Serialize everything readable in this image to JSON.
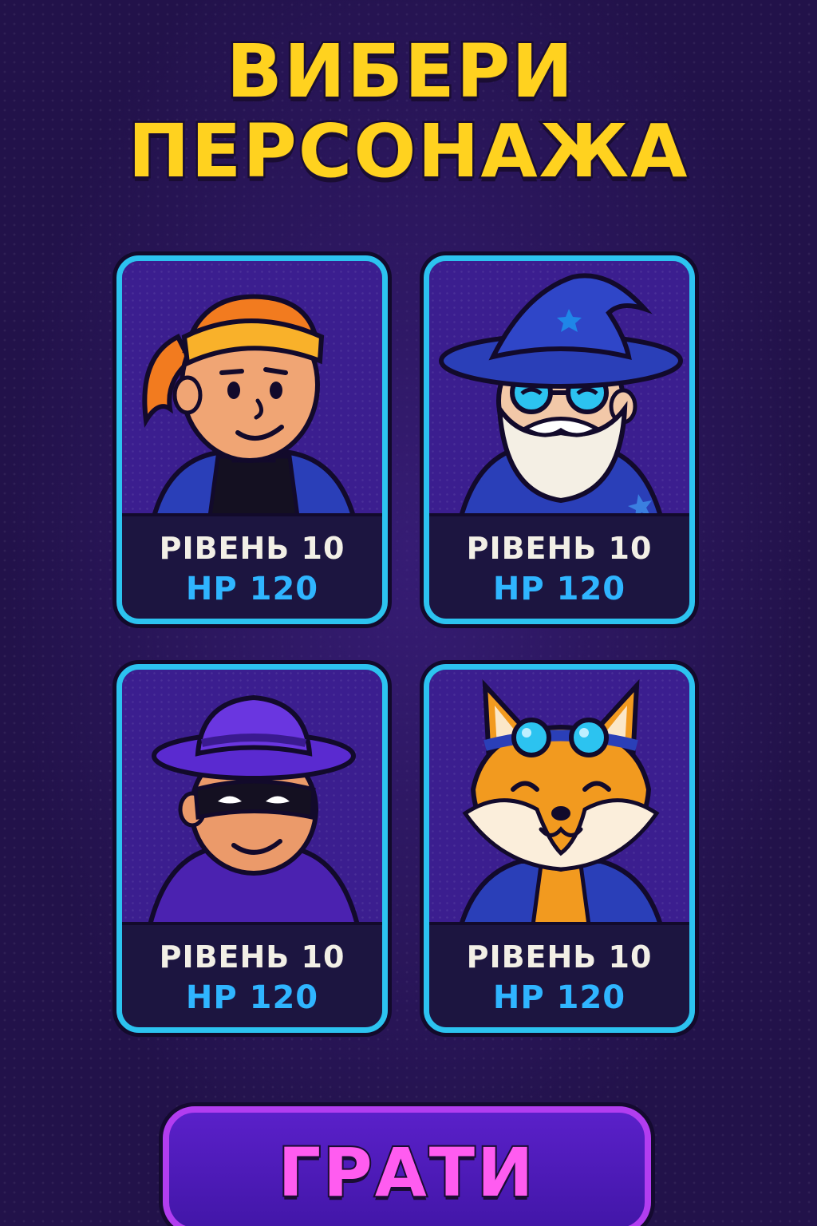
{
  "title": {
    "line1": "ВИБЕРИ",
    "line2": "ПЕРСОНАЖА"
  },
  "characters": [
    {
      "avatar": "adventurer-girl-headband",
      "level_label": "РІВЕНЬ 10",
      "hp_label": "HP 120"
    },
    {
      "avatar": "wizard-with-glasses",
      "level_label": "РІВЕНЬ 10",
      "hp_label": "HP 120"
    },
    {
      "avatar": "masked-thief-with-hat",
      "level_label": "РІВЕНЬ 10",
      "hp_label": "HP 120"
    },
    {
      "avatar": "fox-with-goggles",
      "level_label": "РІВЕНЬ 10",
      "hp_label": "HP 120"
    }
  ],
  "play_button": {
    "label": "ГРАТИ"
  },
  "colors": {
    "background": "#22124a",
    "title": "#ffd21f",
    "card_border": "#2cc3f0",
    "level_text": "#f2efe6",
    "hp_text": "#2fb5ff",
    "play_border": "#b23df0",
    "play_text": "#ff5cf0"
  }
}
